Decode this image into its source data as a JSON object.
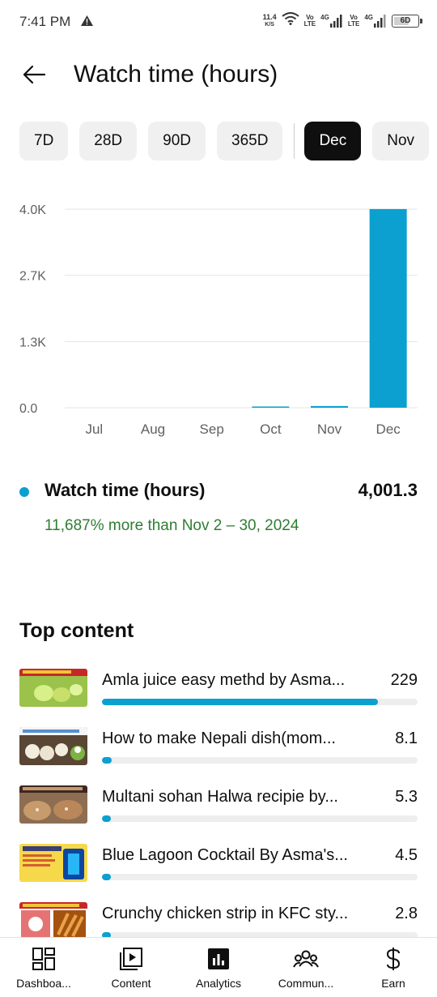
{
  "status_bar": {
    "time": "7:41 PM",
    "net_speed_value": "11.4",
    "net_speed_unit": "K/S",
    "sim1_volte": "Vo",
    "sim1_lte": "LTE",
    "sim1_net": "4G",
    "sim2_volte": "Vo",
    "sim2_lte": "LTE",
    "sim2_net": "4G",
    "battery": "6D"
  },
  "header": {
    "title": "Watch time (hours)"
  },
  "period_chips": [
    {
      "label": "7D",
      "active": false
    },
    {
      "label": "28D",
      "active": false
    },
    {
      "label": "90D",
      "active": false
    },
    {
      "label": "365D",
      "active": false
    },
    {
      "label": "Dec",
      "active": true
    },
    {
      "label": "Nov",
      "active": false
    }
  ],
  "chart_data": {
    "type": "bar",
    "categories": [
      "Jul",
      "Aug",
      "Sep",
      "Oct",
      "Nov",
      "Dec"
    ],
    "values": [
      0,
      0,
      0,
      5,
      34,
      4001.3
    ],
    "y_ticks": [
      "0.0",
      "1.3K",
      "2.7K",
      "4.0K"
    ],
    "ylim": [
      0,
      4000
    ],
    "grid": true,
    "bar_color": "#0ba0cf"
  },
  "summary": {
    "label": "Watch time (hours)",
    "value": "4,001.3",
    "comparison": "11,687% more than Nov 2 – 30, 2024",
    "comparison_color": "#2e7d32"
  },
  "top_content": {
    "title": "Top content",
    "items": [
      {
        "title": "Amla juice easy methd by Asma...",
        "value": "229",
        "fraction": 1.0
      },
      {
        "title": "How to make Nepali dish(mom...",
        "value": "8.1",
        "fraction": 0.0354
      },
      {
        "title": "Multani sohan Halwa recipie  by...",
        "value": "5.3",
        "fraction": 0.0231
      },
      {
        "title": "Blue Lagoon Cocktail By Asma's...",
        "value": "4.5",
        "fraction": 0.0197
      },
      {
        "title": "Crunchy chicken strip in KFC sty...",
        "value": "2.8",
        "fraction": 0.0122
      }
    ]
  },
  "bottom_nav": {
    "items": [
      {
        "label": "Dashboa...",
        "icon": "dashboard-icon"
      },
      {
        "label": "Content",
        "icon": "content-icon"
      },
      {
        "label": "Analytics",
        "icon": "analytics-icon"
      },
      {
        "label": "Commun...",
        "icon": "community-icon"
      },
      {
        "label": "Earn",
        "icon": "earn-icon"
      }
    ]
  },
  "colors": {
    "accent": "#0ba0cf",
    "active_chip": "#0f0f0f",
    "chip_bg": "#f0f0f0"
  }
}
